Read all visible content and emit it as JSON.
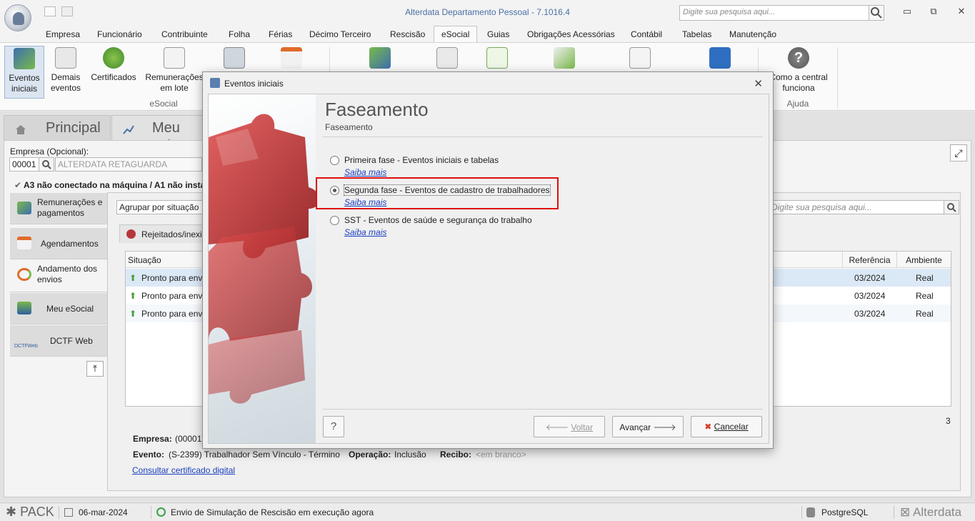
{
  "app": {
    "title": "Alterdata Departamento Pessoal - 7.1016.4",
    "search_placeholder": "Digite sua pesquisa aqui..."
  },
  "window_controls": {
    "minimize": "▭",
    "restore": "⧉",
    "close": "✕"
  },
  "menu": [
    "Empresa",
    "Funcionário",
    "Contribuinte",
    "Folha",
    "Férias",
    "Décimo Terceiro",
    "Rescisão",
    "eSocial",
    "Guias",
    "Obrigações Acessórias",
    "Contábil",
    "Tabelas",
    "Manutenção"
  ],
  "ribbon": {
    "buttons": [
      {
        "label": "Eventos iniciais"
      },
      {
        "label": "Demais eventos"
      },
      {
        "label": "Certificados"
      },
      {
        "label": "Remunerações em lote"
      },
      {
        "label": "Como a central funciona"
      }
    ],
    "groups": [
      "eSocial",
      "Ajuda"
    ]
  },
  "home_tabs": [
    "Principal",
    "Meu setor"
  ],
  "empresa": {
    "label": "Empresa (Opcional):",
    "code": "00001",
    "name": "ALTERDATA RETAGUARDA"
  },
  "cert_warning": "A3 não conectado na máquina / A1 não instal",
  "sidebar": [
    {
      "label": "Remunerações e pagamentos"
    },
    {
      "label": "Agendamentos"
    },
    {
      "label": "Andamento dos envios"
    },
    {
      "label": "Meu eSocial"
    },
    {
      "label": "DCTF Web"
    }
  ],
  "sidebar_icon_text": "DCTFWeb",
  "group_by": "Agrupar por situação",
  "list_search_placeholder": "Digite sua pesquisa aqui...",
  "subtab": "Rejeitados/inexi",
  "table": {
    "headers": [
      "Situação",
      "Referência",
      "Ambiente"
    ],
    "rows": [
      {
        "situacao": "Pronto para env",
        "referencia": "03/2024",
        "ambiente": "Real"
      },
      {
        "situacao": "Pronto para env",
        "referencia": "03/2024",
        "ambiente": "Real"
      },
      {
        "situacao": "Pronto para env",
        "referencia": "03/2024",
        "ambiente": "Real"
      }
    ],
    "count": "3"
  },
  "details": {
    "empresa_label": "Empresa:",
    "empresa_value": "(00001)",
    "evento_label": "Evento:",
    "evento_value": "(S-2399) Trabalhador Sem Vínculo - Término",
    "operacao_label": "Operação:",
    "operacao_value": "Inclusão",
    "recibo_label": "Recibo:",
    "recibo_value": "<em branco>",
    "cert_link": "Consultar certificado digital"
  },
  "dialog": {
    "title": "Eventos iniciais",
    "heading": "Faseamento",
    "subheading": "Faseamento",
    "options": [
      {
        "label": "Primeira fase - Eventos iniciais e tabelas",
        "link": "Saiba mais",
        "selected": false
      },
      {
        "label": "Segunda fase - Eventos de cadastro de trabalhadores",
        "link": "Saiba mais",
        "selected": true
      },
      {
        "label": "SST - Eventos de saúde e segurança do trabalho",
        "link": "Saiba mais",
        "selected": false
      }
    ],
    "help_label": "?",
    "back_label": "Voltar",
    "next_label": "Avançar",
    "cancel_label": "Cancelar"
  },
  "statusbar": {
    "pack": "PACK",
    "date": "06-mar-2024",
    "message": "Envio de Simulação de Rescisão em execução agora",
    "db": "PostgreSQL",
    "brand": "Alterdata"
  }
}
